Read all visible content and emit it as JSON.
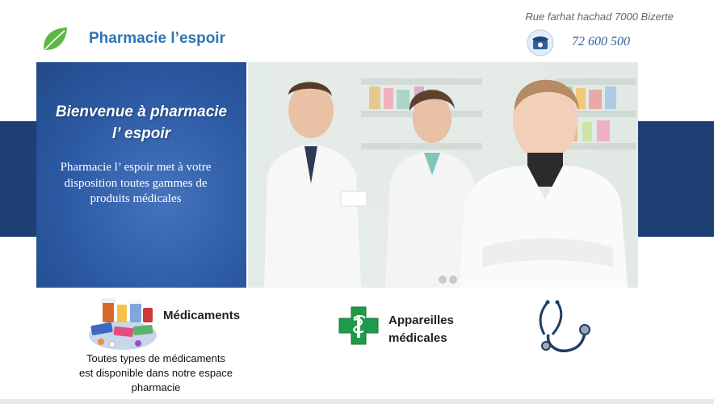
{
  "header": {
    "brand": "Pharmacie l’espoir",
    "address": "Rue farhat hachad 7000 Bizerte",
    "phone": "72 600 500"
  },
  "hero": {
    "title_line1": "Bienvenue à pharmacie",
    "title_line2": "l’ espoir",
    "text": "Pharmacie l’ espoir met à votre disposition toutes gammes de produits médicales"
  },
  "features": [
    {
      "title": "Médicaments",
      "description": "Toutes types de médicaments est disponible dans notre espace pharmacie"
    },
    {
      "title_line1": "Appareilles",
      "title_line2": "médicales"
    }
  ],
  "icons": {
    "logo": "leaf-icon",
    "phone": "phone-icon",
    "medicines": "medicines-icon",
    "pharmacy": "pharmacy-cross-icon",
    "stethoscope": "stethoscope-icon"
  },
  "colors": {
    "brand": "#2f75b5",
    "hero_panel": "#2c5aa3",
    "band": "#1d3f73",
    "cross": "#1f9a4a"
  }
}
